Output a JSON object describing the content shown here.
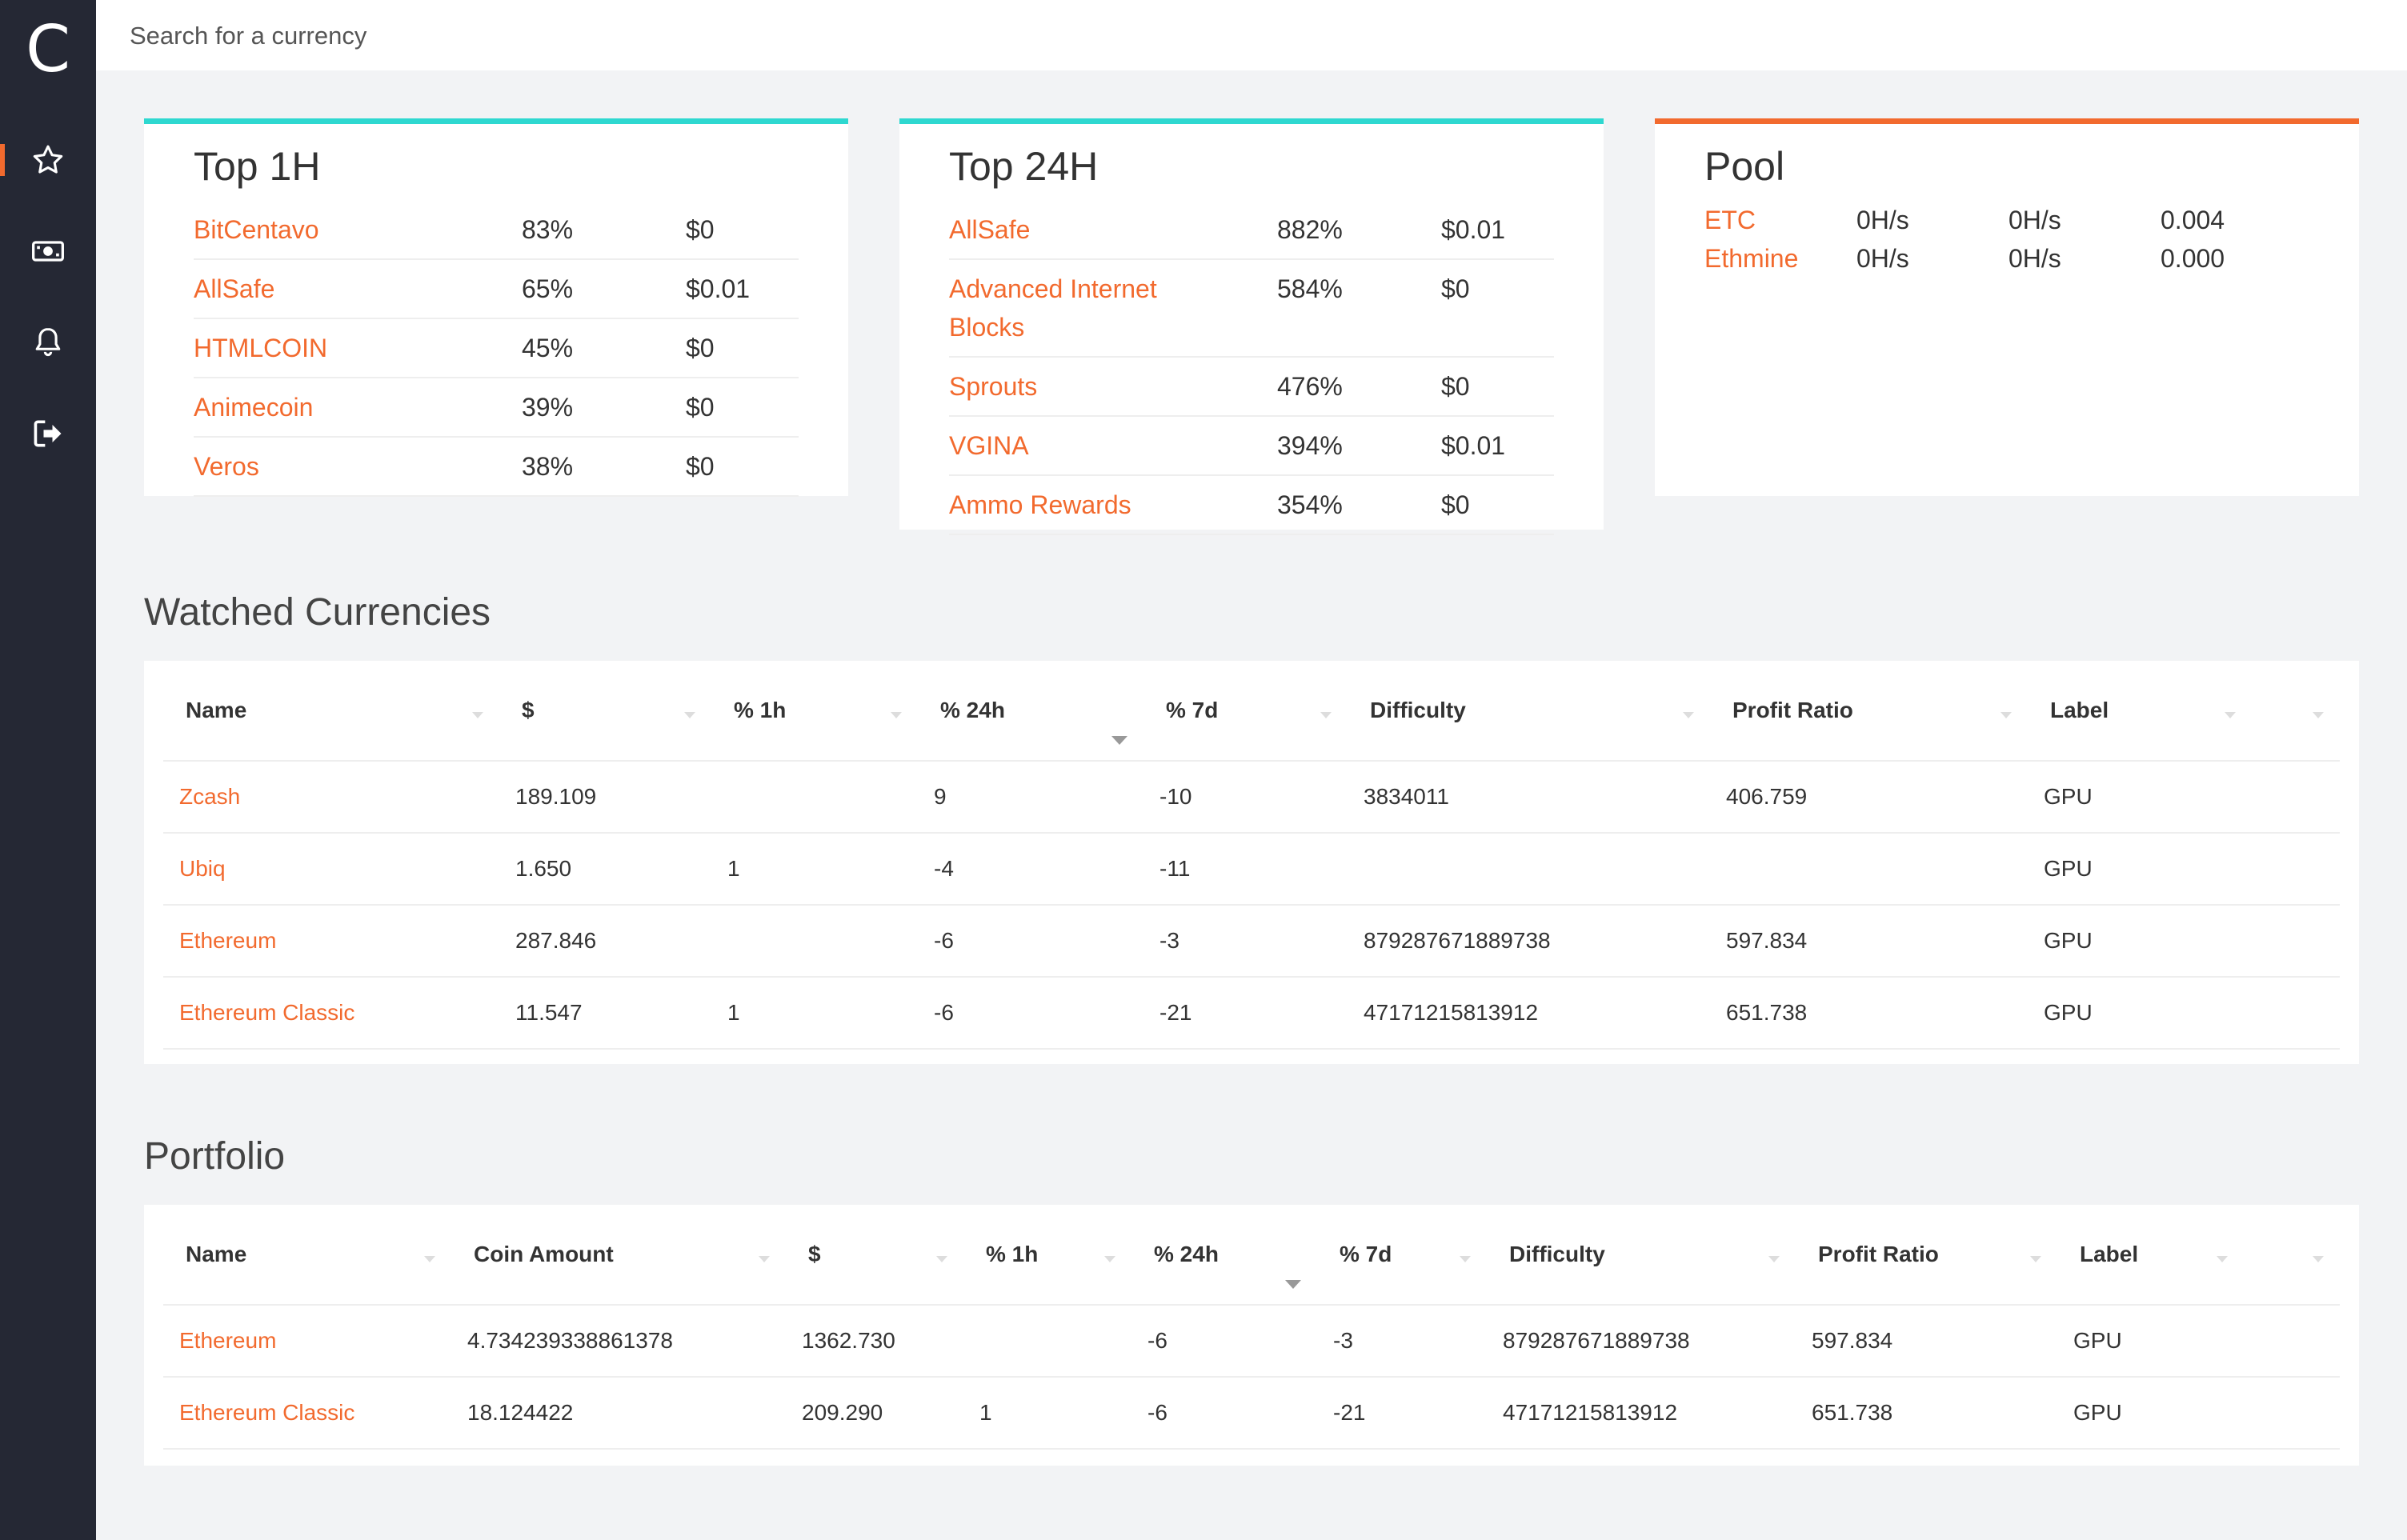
{
  "app": {
    "logo": "C"
  },
  "sidebar": {
    "items": [
      {
        "icon": "star-icon",
        "active": true
      },
      {
        "icon": "money-icon",
        "active": false
      },
      {
        "icon": "bell-icon",
        "active": false
      },
      {
        "icon": "logout-icon",
        "active": false
      }
    ]
  },
  "search": {
    "placeholder": "Search for a currency"
  },
  "colors": {
    "accent": "#f26a2e",
    "teal": "#2ed8d0",
    "sidebar": "#252834"
  },
  "top1h": {
    "title": "Top 1H",
    "rows": [
      {
        "name": "BitCentavo",
        "pct": "83%",
        "price": "$0"
      },
      {
        "name": "AllSafe",
        "pct": "65%",
        "price": "$0.01"
      },
      {
        "name": "HTMLCOIN",
        "pct": "45%",
        "price": "$0"
      },
      {
        "name": "Animecoin",
        "pct": "39%",
        "price": "$0"
      },
      {
        "name": "Veros",
        "pct": "38%",
        "price": "$0"
      }
    ]
  },
  "top24h": {
    "title": "Top 24H",
    "rows": [
      {
        "name": "AllSafe",
        "pct": "882%",
        "price": "$0.01"
      },
      {
        "name": "Advanced Internet Blocks",
        "pct": "584%",
        "price": "$0"
      },
      {
        "name": "Sprouts",
        "pct": "476%",
        "price": "$0"
      },
      {
        "name": "VGINA",
        "pct": "394%",
        "price": "$0.01"
      },
      {
        "name": "Ammo Rewards",
        "pct": "354%",
        "price": "$0"
      }
    ]
  },
  "pool": {
    "title": "Pool",
    "rows": [
      {
        "name": "ETC",
        "h1": "0H/s",
        "h2": "0H/s",
        "value": "0.004"
      },
      {
        "name": "Ethmine",
        "h1": "0H/s",
        "h2": "0H/s",
        "value": "0.000"
      }
    ]
  },
  "watched": {
    "title": "Watched Currencies",
    "headers": [
      "Name",
      "$",
      "% 1h",
      "% 24h",
      "% 7d",
      "Difficulty",
      "Profit Ratio",
      "Label",
      ""
    ],
    "rows": [
      [
        "Zcash",
        "189.109",
        "",
        "9",
        "-10",
        "3834011",
        "406.759",
        "GPU",
        ""
      ],
      [
        "Ubiq",
        "1.650",
        "1",
        "-4",
        "-11",
        "",
        "",
        "GPU",
        ""
      ],
      [
        "Ethereum",
        "287.846",
        "",
        "-6",
        "-3",
        "879287671889738",
        "597.834",
        "GPU",
        ""
      ],
      [
        "Ethereum Classic",
        "11.547",
        "1",
        "-6",
        "-21",
        "47171215813912",
        "651.738",
        "GPU",
        ""
      ]
    ]
  },
  "portfolio": {
    "title": "Portfolio",
    "headers": [
      "Name",
      "Coin Amount",
      "$",
      "% 1h",
      "% 24h",
      "% 7d",
      "Difficulty",
      "Profit Ratio",
      "Label",
      ""
    ],
    "rows": [
      [
        "Ethereum",
        "4.734239338861378",
        "1362.730",
        "",
        "-6",
        "-3",
        "879287671889738",
        "597.834",
        "GPU",
        ""
      ],
      [
        "Ethereum Classic",
        "18.124422",
        "209.290",
        "1",
        "-6",
        "-21",
        "47171215813912",
        "651.738",
        "GPU",
        ""
      ]
    ]
  }
}
